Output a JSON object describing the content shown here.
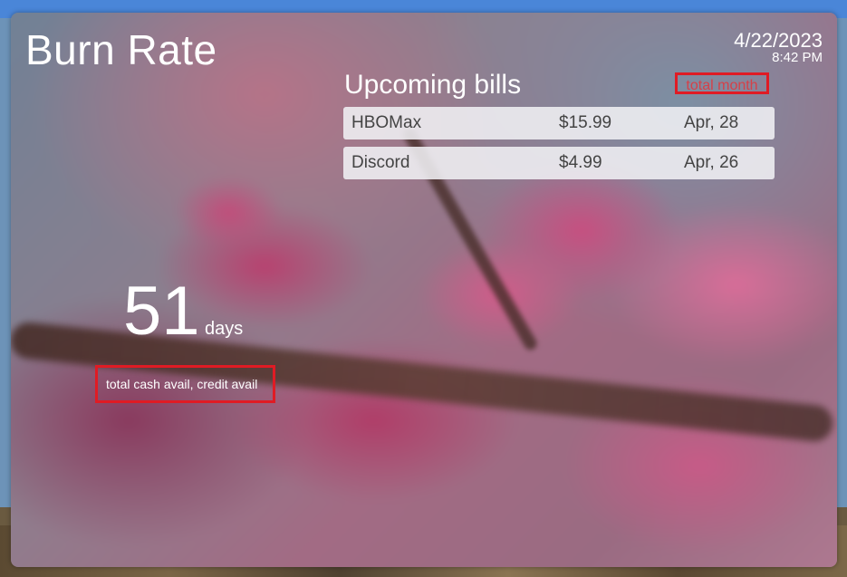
{
  "app": {
    "title": "Burn Rate"
  },
  "datetime": {
    "date": "4/22/2023",
    "time": "8:42 PM"
  },
  "bills": {
    "heading": "Upcoming bills",
    "total_label": "total month",
    "items": [
      {
        "name": "HBOMax",
        "amount": "$15.99",
        "due": "Apr, 28"
      },
      {
        "name": "Discord",
        "amount": "$4.99",
        "due": "Apr, 26"
      }
    ]
  },
  "burn": {
    "days_value": "51",
    "days_unit": "days",
    "cash_note": "total cash avail, credit avail"
  },
  "colors": {
    "accent_outline": "#e01b24",
    "text": "#ffffff",
    "row_bg": "#f0f0f4"
  }
}
